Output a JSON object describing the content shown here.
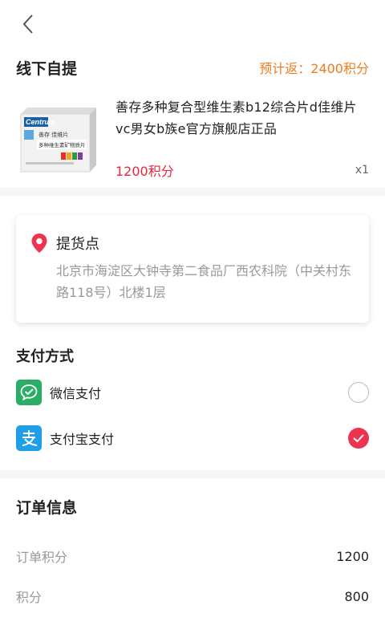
{
  "header": {
    "back_icon": "chevron-left-icon"
  },
  "store": {
    "title": "线下自提",
    "rebate": "预计返：2400积分"
  },
  "product": {
    "name": "善存多种复合型维生素b12综合片d佳维片vc男女b族e官方旗舰店正品",
    "price": "1200积分",
    "qty": "x1",
    "image": {
      "brand": "Centrum",
      "line1": "善存 佳维片",
      "line2": "多种维生素矿物质片"
    }
  },
  "pickup": {
    "icon": "location-pin-icon",
    "title": "提货点",
    "address": "北京市海淀区大钟寺第二食品厂西农科院（中关村东路118号）北楼1层"
  },
  "payment": {
    "title": "支付方式",
    "options": [
      {
        "label": "微信支付",
        "icon": "wechat-pay-icon",
        "selected": false
      },
      {
        "label": "支付宝支付",
        "icon": "alipay-icon",
        "selected": true
      }
    ]
  },
  "order": {
    "title": "订单信息",
    "rows": [
      {
        "label": "订单积分",
        "value": "1200"
      },
      {
        "label": "积分",
        "value": "800"
      }
    ]
  },
  "colors": {
    "accent_orange": "#f07c1e",
    "price_red": "#e5283c",
    "check_red": "#ee3350",
    "wechat_green": "#2aae67",
    "alipay_blue": "#1e9fe8"
  }
}
